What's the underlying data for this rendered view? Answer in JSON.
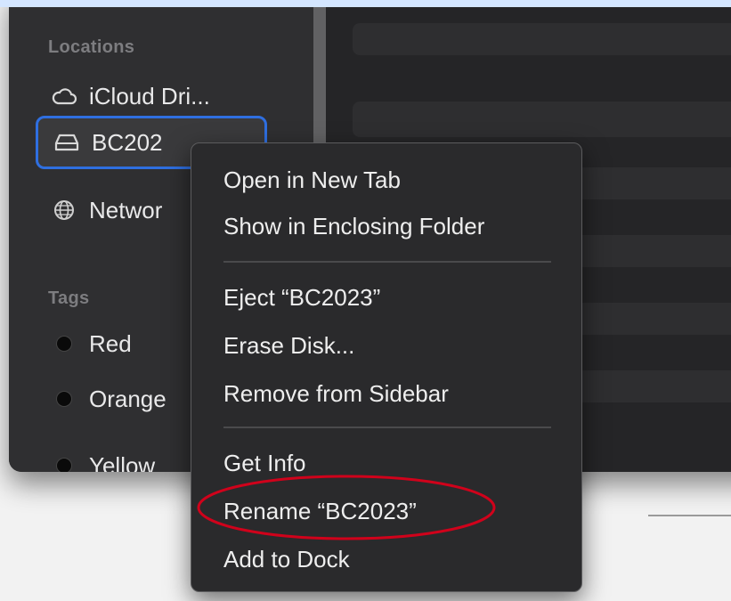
{
  "sidebar": {
    "locations_header": "Locations",
    "locations": [
      {
        "label": "iCloud Dri...",
        "icon": "cloud-icon"
      },
      {
        "label": "BC202",
        "icon": "external-drive-icon",
        "selected": true
      },
      {
        "label": "Networ",
        "icon": "globe-icon"
      }
    ],
    "tags_header": "Tags",
    "tags": [
      {
        "label": "Red",
        "color": "#0a0a0a"
      },
      {
        "label": "Orange",
        "color": "#0a0a0a"
      },
      {
        "label": "Yellow",
        "color": "#0a0a0a"
      }
    ]
  },
  "context_menu": {
    "groups": [
      [
        "Open in New Tab",
        "Show in Enclosing Folder"
      ],
      [
        "Eject “BC2023”",
        "Erase Disk...",
        "Remove from Sidebar"
      ],
      [
        "Get Info",
        "Rename “BC2023”",
        "Add to Dock"
      ]
    ]
  },
  "annotation": {
    "highlight_color": "#d0021b",
    "highlighted_item": "Rename “BC2023”"
  }
}
